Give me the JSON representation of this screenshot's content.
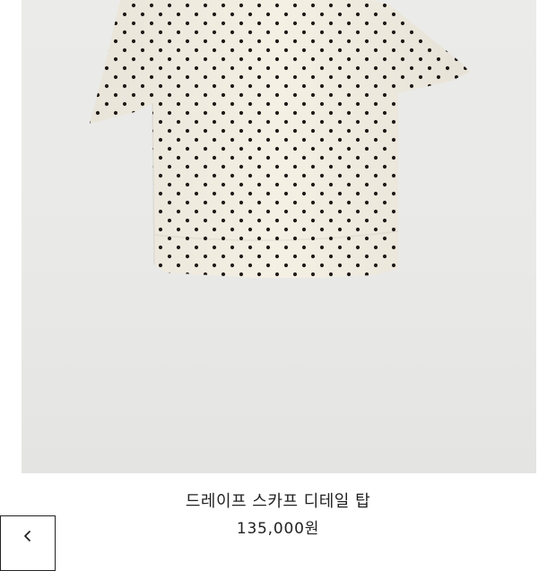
{
  "product": {
    "name": "드레이프 스카프 디테일 탑",
    "price": "135,000원",
    "image_alt": "polka dot short-sleeve top"
  },
  "navigation": {
    "back_icon": "chevron-left-icon",
    "back_label": "‹"
  },
  "colors": {
    "garment": "#f5f0e4",
    "dots": "#1f1a17",
    "background": "#ebebe9",
    "text": "#222222"
  }
}
